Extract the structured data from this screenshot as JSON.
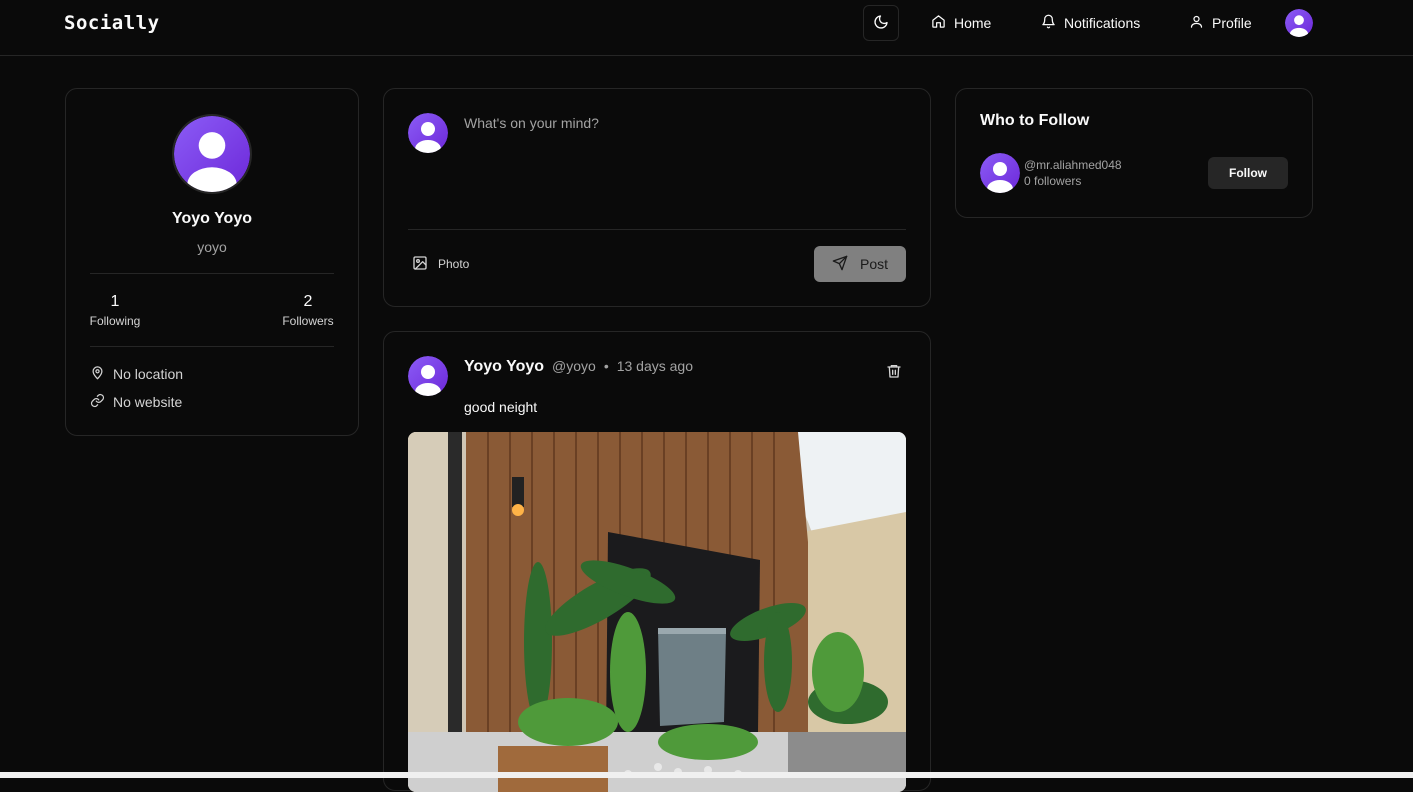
{
  "app": {
    "name": "Socially"
  },
  "colors": {
    "accent_start": "#8b5cf6",
    "accent_end": "#6d28d9",
    "background": "#0a0a0a",
    "border": "#262626"
  },
  "nav": {
    "theme_icon": "moon-icon",
    "items": [
      {
        "label": "Home",
        "icon": "home-icon"
      },
      {
        "label": "Notifications",
        "icon": "bell-icon"
      },
      {
        "label": "Profile",
        "icon": "user-icon"
      }
    ]
  },
  "profile": {
    "name": "Yoyo Yoyo",
    "username": "yoyo",
    "following_count": "1",
    "following_label": "Following",
    "followers_count": "2",
    "followers_label": "Followers",
    "location": "No location",
    "website": "No website"
  },
  "composer": {
    "placeholder": "What's on your mind?",
    "photo_label": "Photo",
    "post_label": "Post"
  },
  "post": {
    "author": "Yoyo Yoyo",
    "handle": "@yoyo",
    "separator": "•",
    "time": "13 days ago",
    "content": "good neight"
  },
  "who_to_follow": {
    "title": "Who to Follow",
    "users": [
      {
        "handle": "@mr.aliahmed048",
        "followers": "0 followers",
        "button": "Follow"
      }
    ]
  }
}
